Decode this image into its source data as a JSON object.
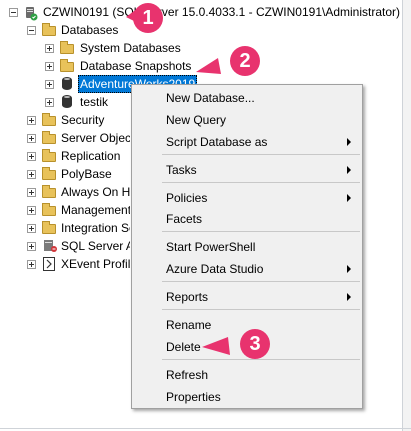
{
  "tree": {
    "server": "CZWIN0191 (SQL Server 15.0.4033.1 - CZWIN0191\\Administrator)",
    "databases": "Databases",
    "system_databases": "System Databases",
    "database_snapshots": "Database Snapshots",
    "adventureworks": "AdventureWorks2019",
    "testik": "testik",
    "security": "Security",
    "server_objects": "Server Objects",
    "replication": "Replication",
    "polybase": "PolyBase",
    "always_on": "Always On High Availability",
    "management": "Management",
    "integration_services": "Integration Services Catalogs",
    "sql_server_agent": "SQL Server Agent (Agent XPs disabled)",
    "xevent_profiler": "XEvent Profiler"
  },
  "context_menu": {
    "new_database": "New Database...",
    "new_query": "New Query",
    "script_database_as": "Script Database as",
    "tasks": "Tasks",
    "policies": "Policies",
    "facets": "Facets",
    "start_powershell": "Start PowerShell",
    "azure_data_studio": "Azure Data Studio",
    "reports": "Reports",
    "rename": "Rename",
    "delete": "Delete",
    "refresh": "Refresh",
    "properties": "Properties"
  },
  "callouts": {
    "one": "1",
    "two": "2",
    "three": "3"
  },
  "colors": {
    "selection": "#0078d7",
    "callout": "#e8336e",
    "folder": "#e8c25a"
  },
  "icons": [
    "server-icon",
    "folder-icon",
    "database-icon",
    "xevent-icon",
    "expand-icon",
    "collapse-icon",
    "submenu-arrow-icon"
  ]
}
